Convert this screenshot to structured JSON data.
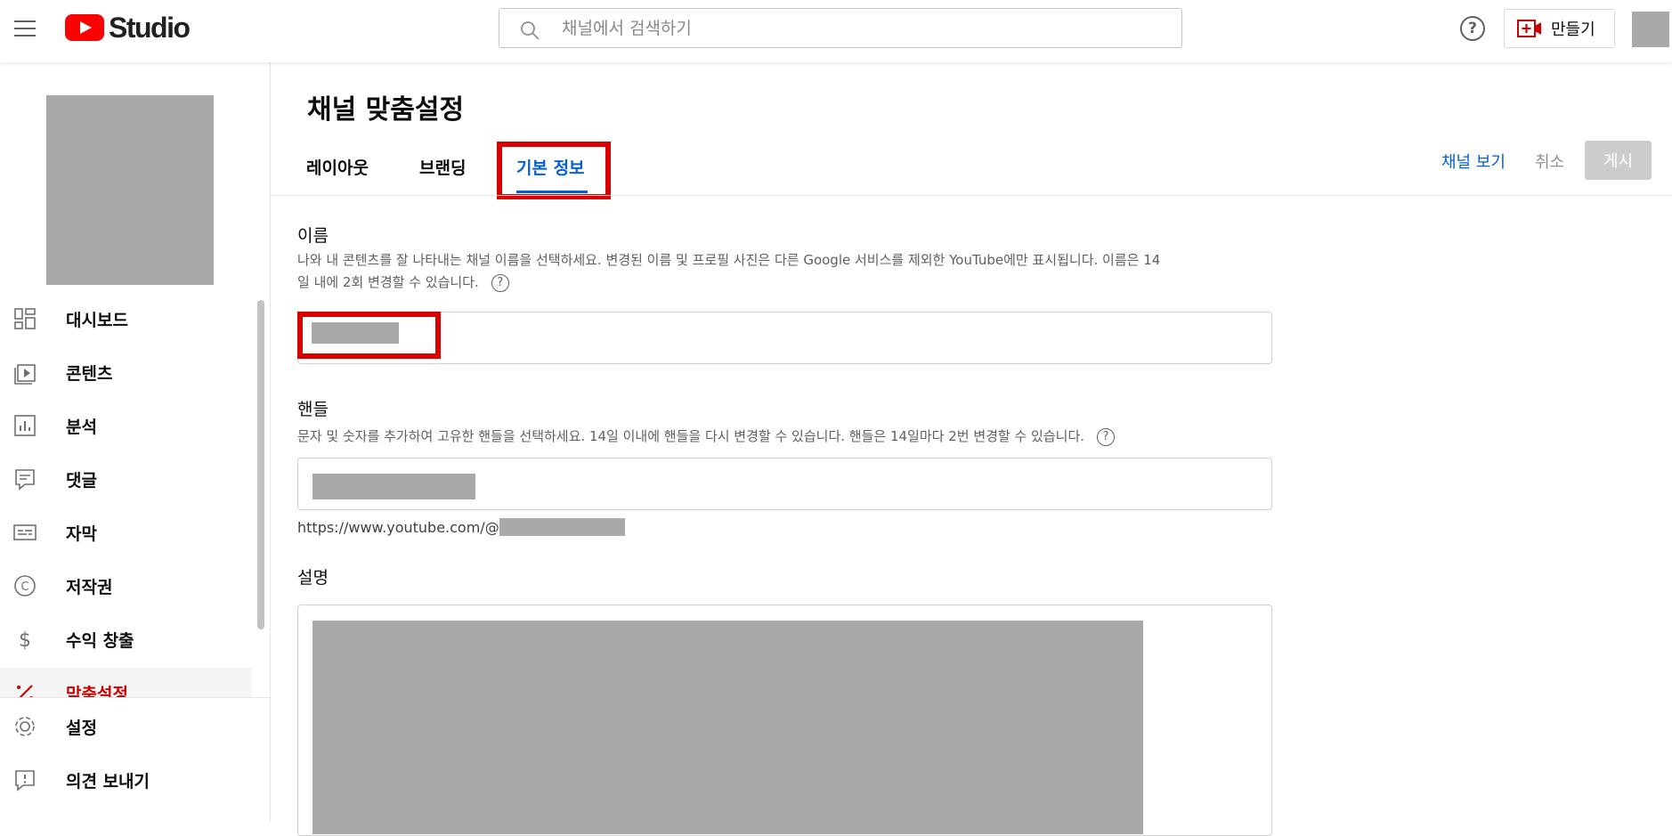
{
  "header": {
    "logo_text": "Studio",
    "search_placeholder": "채널에서 검색하기",
    "create_label": "만들기",
    "help_label": "?"
  },
  "sidebar": {
    "items": [
      {
        "label": "대시보드",
        "icon": "dashboard-icon"
      },
      {
        "label": "콘텐츠",
        "icon": "content-icon"
      },
      {
        "label": "분석",
        "icon": "analytics-icon"
      },
      {
        "label": "댓글",
        "icon": "comments-icon"
      },
      {
        "label": "자막",
        "icon": "subtitles-icon"
      },
      {
        "label": "저작권",
        "icon": "copyright-icon"
      },
      {
        "label": "수익 창출",
        "icon": "monetization-icon"
      },
      {
        "label": "맞춤설정",
        "icon": "customization-icon",
        "active": true
      }
    ],
    "bottom_items": [
      {
        "label": "설정",
        "icon": "settings-icon"
      },
      {
        "label": "의견 보내기",
        "icon": "feedback-icon"
      }
    ]
  },
  "main": {
    "title": "채널 맞춤설정",
    "tabs": [
      {
        "label": "레이아웃"
      },
      {
        "label": "브랜딩"
      },
      {
        "label": "기본 정보",
        "selected": true
      }
    ],
    "actions": {
      "view_channel": "채널 보기",
      "cancel": "취소",
      "publish": "게시"
    },
    "name_section": {
      "label": "이름",
      "desc_line1": "나와 내 콘텐츠를 잘 나타내는 채널 이름을 선택하세요. 변경된 이름 및 프로필 사진은 다른 Google 서비스를 제외한 YouTube에만 표시됩니다. 이름은 14",
      "desc_line2": "일 내에 2회 변경할 수 있습니다."
    },
    "handle_section": {
      "label": "핸들",
      "desc": "문자 및 숫자를 추가하여 고유한 핸들을 선택하세요. 14일 이내에 핸들을 다시 변경할 수 있습니다. 핸들은 14일마다 2번 변경할 수 있습니다.",
      "url_prefix": "https://www.youtube.com/@"
    },
    "description_section": {
      "label": "설명"
    }
  },
  "colors": {
    "accent_blue": "#065fd4",
    "highlight_red": "#d90000",
    "brand_red": "#ff0000"
  }
}
